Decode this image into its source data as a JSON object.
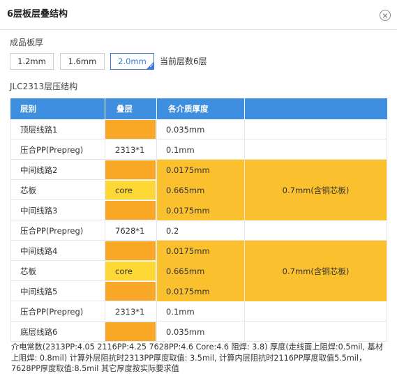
{
  "header": {
    "title": "6层板层叠结构"
  },
  "thickness": {
    "label": "成品板厚",
    "options": [
      "1.2mm",
      "1.6mm",
      "2.0mm"
    ],
    "selected": "2.0mm",
    "current_layers": "当前层数6层"
  },
  "structure_title": "JLC2313层压结构",
  "table": {
    "headers": [
      "层别",
      "叠层",
      "各介质厚度",
      ""
    ],
    "rows": [
      {
        "name": "顶层线路1",
        "stack": "",
        "thickness": "0.035mm",
        "fill": "#f9a825"
      },
      {
        "name": "压合PP(Prepreg)",
        "stack": "2313*1",
        "thickness": "0.1mm",
        "fill": ""
      },
      {
        "name": "中间线路2",
        "stack": "",
        "thickness": "0.0175mm",
        "fill": "#f9a825"
      },
      {
        "name": "芯板",
        "stack": "core",
        "thickness": "0.665mm",
        "fill": "#fdd835"
      },
      {
        "name": "中间线路3",
        "stack": "",
        "thickness": "0.0175mm",
        "fill": "#f9a825"
      },
      {
        "name": "压合PP(Prepreg)",
        "stack": "7628*1",
        "thickness": "0.2",
        "fill": ""
      },
      {
        "name": "中间线路4",
        "stack": "",
        "thickness": "0.0175mm",
        "fill": "#f9a825"
      },
      {
        "name": "芯板",
        "stack": "core",
        "thickness": "0.665mm",
        "fill": "#fdd835"
      },
      {
        "name": "中间线路5",
        "stack": "",
        "thickness": "0.0175mm",
        "fill": "#f9a825"
      },
      {
        "name": "压合PP(Prepreg)",
        "stack": "2313*1",
        "thickness": "0.1mm",
        "fill": ""
      },
      {
        "name": "底层线路6",
        "stack": "",
        "thickness": "0.035mm",
        "fill": "#f9a825"
      }
    ],
    "core_groups": [
      {
        "label": "0.7mm(含铜芯板)"
      },
      {
        "label": "0.7mm(含铜芯板)"
      }
    ]
  },
  "note": "介电常数(2313PP:4.05 2116PP:4.25 7628PP:4.6 Core:4.6 阻焊: 3.8) 厚度(走线面上阻焊:0.5mil, 基材上阻焊: 0.8mil) 计算外层阻抗时2313PP厚度取值: 3.5mil, 计算内层阻抗时2116PP厚度取值5.5mil，7628PP厚度取值:8.5mil 其它厚度按实际要求值",
  "colors": {
    "header_blue": "#3e8fe0",
    "copper": "#f9a825",
    "core": "#fdd835",
    "core_band": "#fbc02d",
    "accent": "#3a7bd5"
  }
}
